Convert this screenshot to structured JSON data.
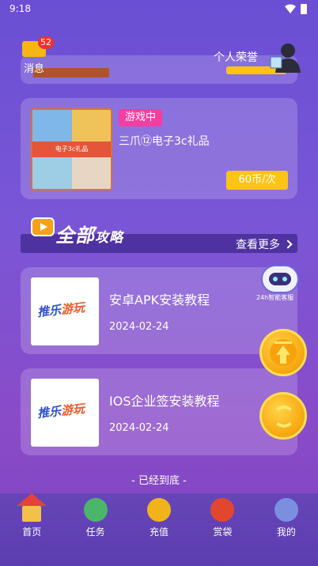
{
  "status_bar": {
    "time": "9:18"
  },
  "header": {
    "messages_label": "消息",
    "messages_badge": "52",
    "honor_label": "个人荣誉"
  },
  "prize_card": {
    "status_tag": "游戏中",
    "name": "三爪⑫电子3c礼品",
    "image_caption": "电子3c礼品",
    "price": "60币/次"
  },
  "section": {
    "title_big": "全部",
    "title_small": "攻略",
    "more_label": "查看更多"
  },
  "guides": [
    {
      "title": "安卓APK安装教程",
      "date": "2024-02-24",
      "logo_a": "推乐",
      "logo_b": "游玩"
    },
    {
      "title": "IOS企业签安装教程",
      "date": "2024-02-24",
      "logo_a": "推乐",
      "logo_b": "游玩"
    }
  ],
  "floating": {
    "service_label": "24h智能客服"
  },
  "end_text": "- 已经到底 -",
  "tabbar": {
    "items": [
      {
        "label": "首页",
        "icon": "home-icon"
      },
      {
        "label": "任务",
        "icon": "task-icon"
      },
      {
        "label": "充值",
        "icon": "recharge-icon"
      },
      {
        "label": "赏袋",
        "icon": "reward-bag-icon"
      },
      {
        "label": "我的",
        "icon": "profile-icon"
      }
    ]
  },
  "colors": {
    "accent_yellow": "#ffc316",
    "tag_pink": "#f03fa2",
    "badge_red": "#f2322d"
  }
}
